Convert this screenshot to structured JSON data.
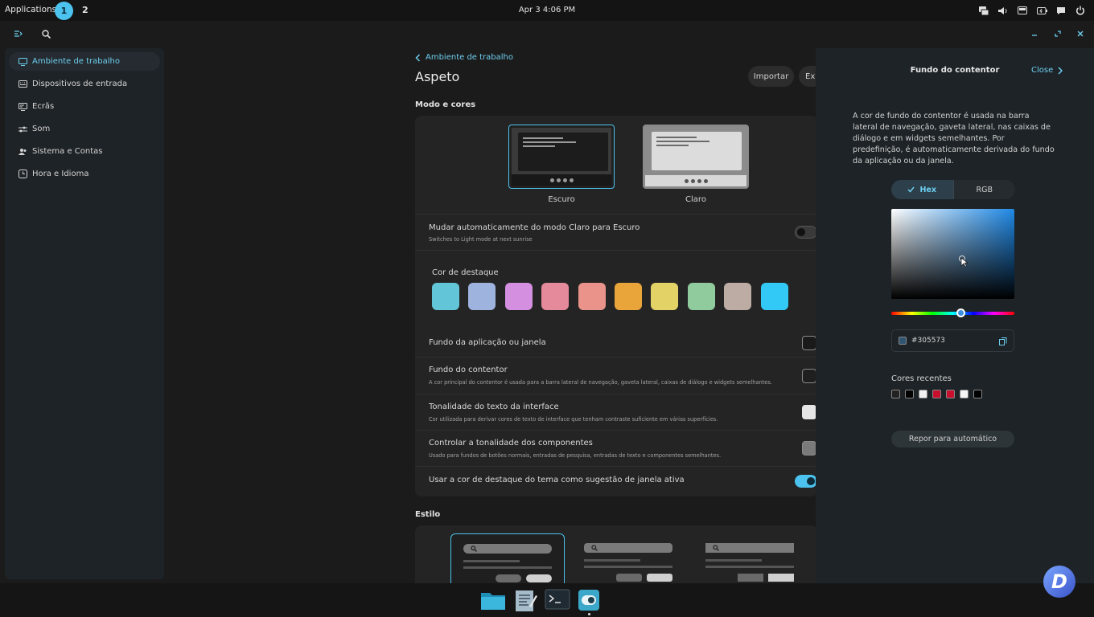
{
  "topbar": {
    "applications": "Applications",
    "workspaces": [
      "1",
      "2"
    ],
    "clock": "Apr 3 4:06 PM"
  },
  "sidebar": {
    "items": [
      {
        "label": "Ambiente de trabalho",
        "icon": "desktop-icon"
      },
      {
        "label": "Dispositivos de entrada",
        "icon": "keyboard-icon"
      },
      {
        "label": "Ecrãs",
        "icon": "display-icon"
      },
      {
        "label": "Som",
        "icon": "sound-icon"
      },
      {
        "label": "Sistema e Contas",
        "icon": "users-icon"
      },
      {
        "label": "Hora e Idioma",
        "icon": "clock-icon"
      }
    ]
  },
  "main": {
    "back_label": "Ambiente de trabalho",
    "title": "Aspeto",
    "import_label": "Importar",
    "export_label": "Exp",
    "mode_section": "Modo e cores",
    "themes": [
      {
        "label": "Escuro"
      },
      {
        "label": "Claro"
      }
    ],
    "auto_mode": {
      "title": "Mudar automaticamente do modo Claro para Escuro",
      "sub": "Switches to Light mode at next sunrise"
    },
    "accent_label": "Cor de destaque",
    "accent_colors": [
      "#63c5d8",
      "#9eb3de",
      "#d58fe0",
      "#e58a9a",
      "#e9938a",
      "#e9a53a",
      "#e3d366",
      "#8fcb9c",
      "#bcaca4",
      "#33c9f7"
    ],
    "rows": [
      {
        "title": "Fundo da aplicação ou janela",
        "sub": ""
      },
      {
        "title": "Fundo do contentor",
        "sub": "A cor principal do contentor é usada para a barra lateral de navegação, gaveta lateral, caixas de diálogo e widgets semelhantes."
      },
      {
        "title": "Tonalidade do texto da interface",
        "sub": "Cor utilizada para derivar cores de texto de interface que tenham contraste suficiente em várias superfícies."
      },
      {
        "title": "Controlar a tonalidade dos componentes",
        "sub": "Usado para fundos de botões normais, entradas de pesquisa, entradas de texto e componentes semelhantes."
      },
      {
        "title": "Usar a cor de destaque do tema como sugestão de janela ativa",
        "sub": ""
      }
    ],
    "style_section": "Estilo"
  },
  "panel": {
    "title": "Fundo do contentor",
    "close_label": "Close",
    "description": "A cor de fundo do contentor é usada na barra lateral de navegação, gaveta lateral, nas caixas de diálogo e em widgets semelhantes. Por predefinição, é automaticamente derivada do fundo da aplicação ou da janela.",
    "tabs": [
      "Hex",
      "RGB"
    ],
    "hex_value": "#305573",
    "recent_label": "Cores recentes",
    "recent_colors": [
      "#222222",
      "#000000",
      "#f2f2f2",
      "#c8102e",
      "#c8102e",
      "#f5f5f5",
      "#000000"
    ],
    "reset_label": "Repor para automático"
  },
  "colors": {
    "accent": "#4cc3ee"
  }
}
